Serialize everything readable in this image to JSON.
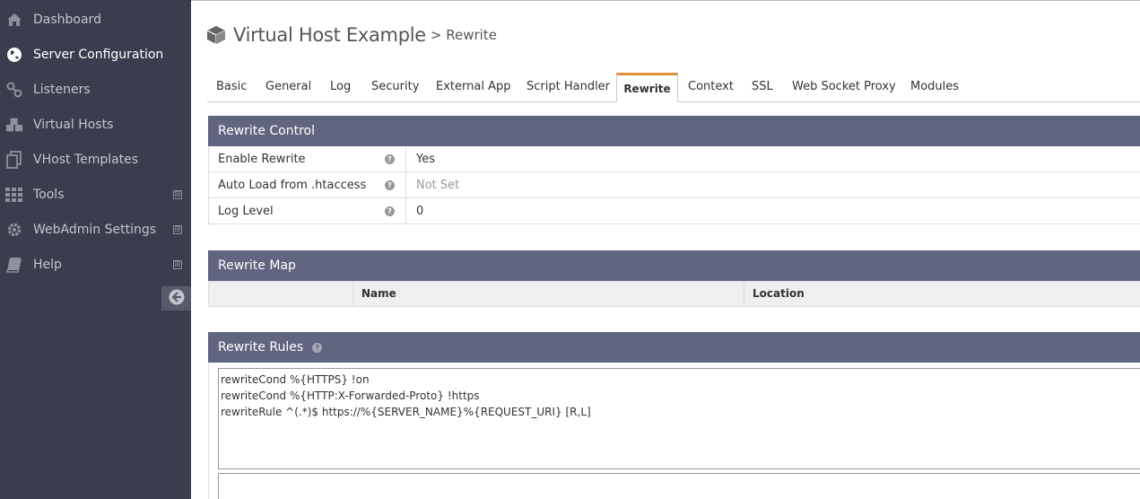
{
  "sidebar": {
    "items": [
      {
        "label": "Dashboard",
        "icon": "home-icon",
        "expandable": false
      },
      {
        "label": "Server Configuration",
        "icon": "globe-icon",
        "expandable": false,
        "active": true
      },
      {
        "label": "Listeners",
        "icon": "link-icon",
        "expandable": false
      },
      {
        "label": "Virtual Hosts",
        "icon": "cubes-icon",
        "expandable": false
      },
      {
        "label": "VHost Templates",
        "icon": "copy-icon",
        "expandable": false
      },
      {
        "label": "Tools",
        "icon": "grid-icon",
        "expandable": true,
        "expand_symbol": "⊞"
      },
      {
        "label": "WebAdmin Settings",
        "icon": "gear-icon",
        "expandable": true,
        "expand_symbol": "⊞"
      },
      {
        "label": "Help",
        "icon": "book-icon",
        "expandable": true,
        "expand_symbol": "⊞"
      }
    ],
    "collapse_icon": "arrow-circle-left-icon"
  },
  "header": {
    "title": "Virtual Host Example",
    "breadcrumb": "> Rewrite"
  },
  "tabs": [
    {
      "label": "Basic"
    },
    {
      "label": "General"
    },
    {
      "label": "Log"
    },
    {
      "label": "Security"
    },
    {
      "label": "External App"
    },
    {
      "label": "Script Handler"
    },
    {
      "label": "Rewrite",
      "active": true
    },
    {
      "label": "Context"
    },
    {
      "label": "SSL"
    },
    {
      "label": "Web Socket Proxy"
    },
    {
      "label": "Modules"
    }
  ],
  "rewrite_control": {
    "title": "Rewrite Control",
    "rows": [
      {
        "label": "Enable Rewrite",
        "value": "Yes"
      },
      {
        "label": "Auto Load from .htaccess",
        "value": "Not Set"
      },
      {
        "label": "Log Level",
        "value": "0"
      }
    ],
    "help_symbol": "?"
  },
  "rewrite_map": {
    "title": "Rewrite Map",
    "columns": [
      "Name",
      "Location"
    ]
  },
  "rewrite_rules": {
    "title": "Rewrite Rules",
    "help_symbol": "?",
    "content": "rewriteCond %{HTTPS} !on\nrewriteCond %{HTTP:X-Forwarded-Proto} !https\nrewriteRule ^(.*)$ https://%{SERVER_NAME}%{REQUEST_URI} [R,L]"
  },
  "colors": {
    "sidebar_bg": "#3a3d4e",
    "panel_header": "#626580",
    "active_tab_accent": "#e28f3e"
  }
}
